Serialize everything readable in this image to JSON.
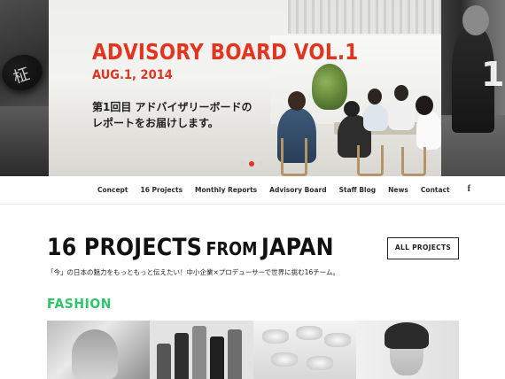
{
  "hero": {
    "title": "ADVISORY BOARD VOL.1",
    "date": "AUG.1, 2014",
    "description_line1": "第1回目 アドバイザリーボードの",
    "description_line2": "レポートをお届けします。",
    "slide_number": "1",
    "stamp_glyph": "柾",
    "active_slide": 2,
    "slide_count": 3
  },
  "nav": {
    "items": [
      "Concept",
      "16 Projects",
      "Monthly Reports",
      "Advisory Board",
      "Staff Blog",
      "News",
      "Contact"
    ],
    "facebook_icon": "f"
  },
  "main": {
    "title_part1": "16 PROJECTS",
    "title_part2": "FROM",
    "title_part3": "JAPAN",
    "all_projects_label": "ALL PROJECTS",
    "subtext": "「今」の日本の魅力をもっともっと伝えたい！中小企業×プロデューサーで世界に挑む16チーム。",
    "section_label": "FASHION"
  },
  "colors": {
    "accent_red": "#e2341f",
    "fashion_green": "#2fc56a"
  }
}
